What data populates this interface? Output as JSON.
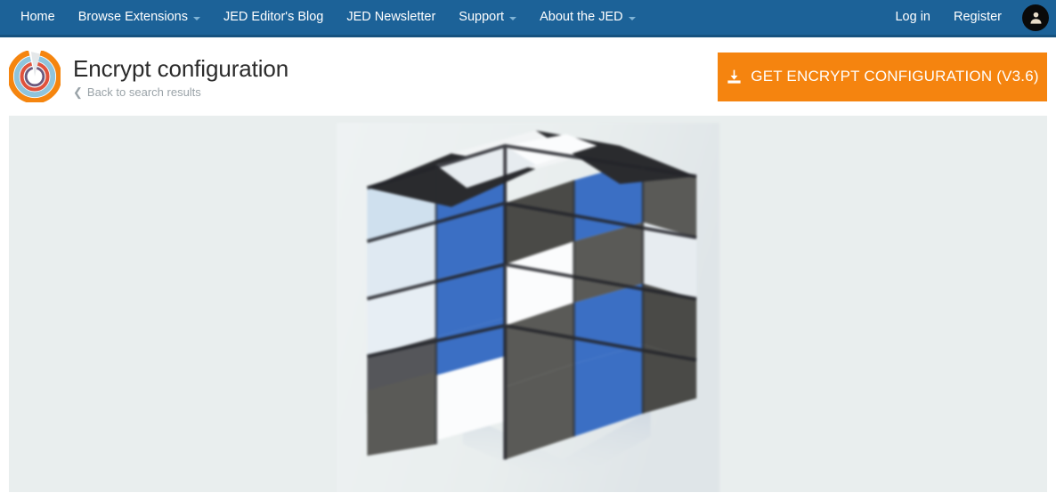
{
  "navbar": {
    "background_color": "#1C6298",
    "left_items": [
      {
        "label": "Home",
        "has_caret": false,
        "icon": ""
      },
      {
        "label": "Browse Extensions",
        "has_caret": true,
        "icon": "chevron-down-icon"
      },
      {
        "label": "JED Editor's Blog",
        "has_caret": false,
        "icon": ""
      },
      {
        "label": "JED Newsletter",
        "has_caret": false,
        "icon": ""
      },
      {
        "label": "Support",
        "has_caret": true,
        "icon": "chevron-down-icon"
      },
      {
        "label": "About the JED",
        "has_caret": true,
        "icon": "chevron-down-icon"
      }
    ],
    "right_items": [
      {
        "label": "Log in"
      },
      {
        "label": "Register"
      }
    ],
    "avatar": {
      "icon": "user-avatar-icon",
      "background_color": "#0A0A0A"
    }
  },
  "header": {
    "logo": {
      "icon": "jed-logo-icon",
      "ring_colors": [
        "#F5850F",
        "#8FC4DC",
        "#E0523C",
        "#6B5A7E"
      ]
    },
    "title": "Encrypt configuration",
    "back_link": {
      "label": "Back to search results",
      "icon": "chevron-left-icon"
    },
    "download_button": {
      "label": "GET ENCRYPT CONFIGURATION (V3.6)",
      "icon": "download-icon",
      "version": "V3.6",
      "background_color": "#F5840F",
      "text_color": "#FFFFFF"
    }
  },
  "screenshot_panel": {
    "background_color": "#E9EEEE",
    "image": {
      "name": "extension-screenshot",
      "description": "Pixelated blurry 3D Rubik's style cube with blue, white and dark grey faces on a light background",
      "colors": {
        "blue": "#3B6FC4",
        "blue_light": "#4E86D8",
        "white": "#FBFCFD",
        "off_white": "#E7ECF0",
        "pale_blue": "#CFE0EE",
        "grey": "#5A5A57",
        "grey_dark": "#3A3A38",
        "black": "#1E1F22"
      }
    }
  }
}
